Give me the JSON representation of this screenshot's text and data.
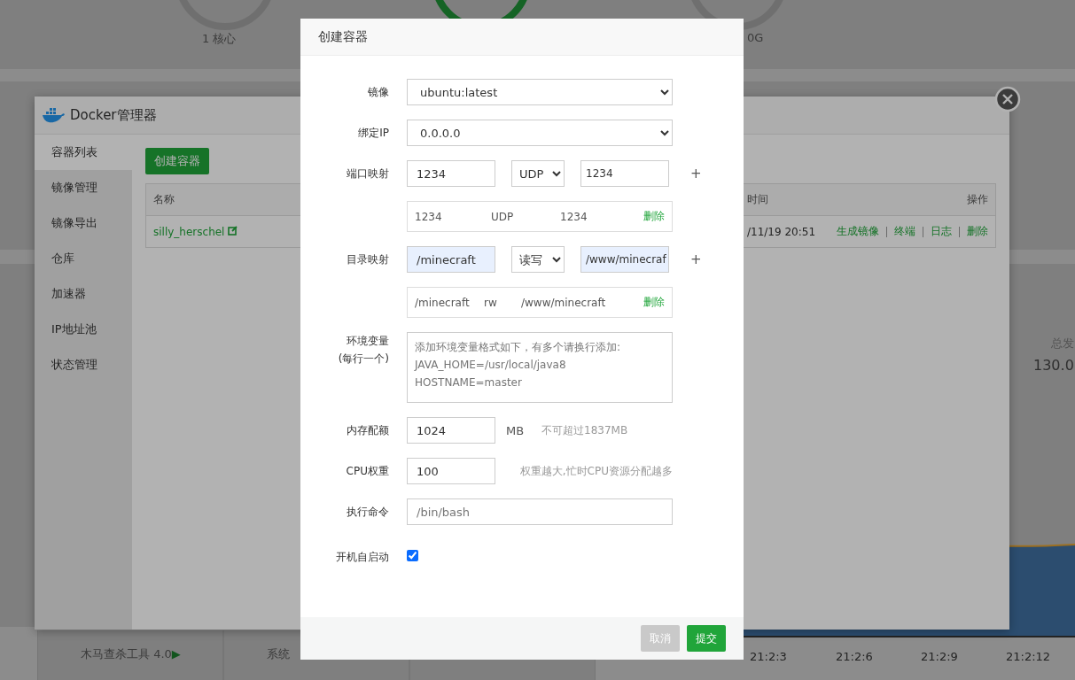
{
  "dashboard": {
    "stats": [
      {
        "label": "1 核心"
      },
      {
        "label": "0G"
      }
    ],
    "traffic": {
      "label": "总发",
      "value": "130.0"
    },
    "chart_ticks": [
      "21:2:3",
      "21:2:6",
      "21:2:9",
      "21:2:12"
    ],
    "tools": [
      {
        "label": "木马查杀工具 4.0",
        "arrow": "▶"
      },
      {
        "label": "系统"
      }
    ]
  },
  "docker_window": {
    "title": "Docker管理器",
    "sidebar": [
      {
        "label": "容器列表",
        "selected": true
      },
      {
        "label": "镜像管理",
        "selected": false
      },
      {
        "label": "镜像导出",
        "selected": false
      },
      {
        "label": "仓库",
        "selected": false
      },
      {
        "label": "加速器",
        "selected": false
      },
      {
        "label": "IP地址池",
        "selected": false
      },
      {
        "label": "状态管理",
        "selected": false
      }
    ],
    "create_button": "创建容器",
    "table": {
      "columns": [
        "名称",
        "时间",
        "操作"
      ],
      "rows": [
        {
          "name": "silly_herschel",
          "time": "/11/19 20:51",
          "actions": [
            "生成镜像",
            "终端",
            "日志",
            "删除"
          ]
        }
      ]
    }
  },
  "dialog": {
    "title": "创建容器",
    "fields": [
      {
        "kind": "select",
        "label": "镜像",
        "value": "ubuntu:latest"
      },
      {
        "kind": "select",
        "label": "绑定IP",
        "value": "0.0.0.0"
      },
      {
        "kind": "mapping",
        "label": "端口映射",
        "left": {
          "value": "1234",
          "autofilled": false
        },
        "mode": "UDP",
        "right": {
          "value": "1234",
          "autofilled": false
        },
        "add": "+",
        "entries": [
          {
            "cells": [
              "1234",
              "UDP",
              "1234"
            ],
            "delete": "删除"
          }
        ]
      },
      {
        "kind": "mapping",
        "label": "目录映射",
        "left": {
          "value": "/minecraft",
          "autofilled": true
        },
        "mode": "读写",
        "right": {
          "value": "/www/minecraf",
          "autofilled": true
        },
        "add": "+",
        "entries": [
          {
            "cells": [
              "/minecraft",
              "rw",
              "/www/minecraft"
            ],
            "delete": "删除"
          }
        ]
      },
      {
        "kind": "textarea",
        "label": "环境变量",
        "sublabel": "(每行一个)",
        "placeholder": "添加环境变量格式如下，有多个请换行添加:\nJAVA_HOME=/usr/local/java8\nHOSTNAME=master"
      },
      {
        "kind": "number",
        "label": "内存配额",
        "value": "1024",
        "unit": "MB",
        "hint": "不可超过1837MB"
      },
      {
        "kind": "number",
        "label": "CPU权重",
        "value": "100",
        "hint": "权重越大,忙时CPU资源分配越多"
      },
      {
        "kind": "text",
        "label": "执行命令",
        "placeholder": "/bin/bash"
      },
      {
        "kind": "checkbox",
        "label": "开机自启动",
        "checked": true
      }
    ],
    "buttons": [
      {
        "label": "取消",
        "primary": false
      },
      {
        "label": "提交",
        "primary": true
      }
    ]
  }
}
